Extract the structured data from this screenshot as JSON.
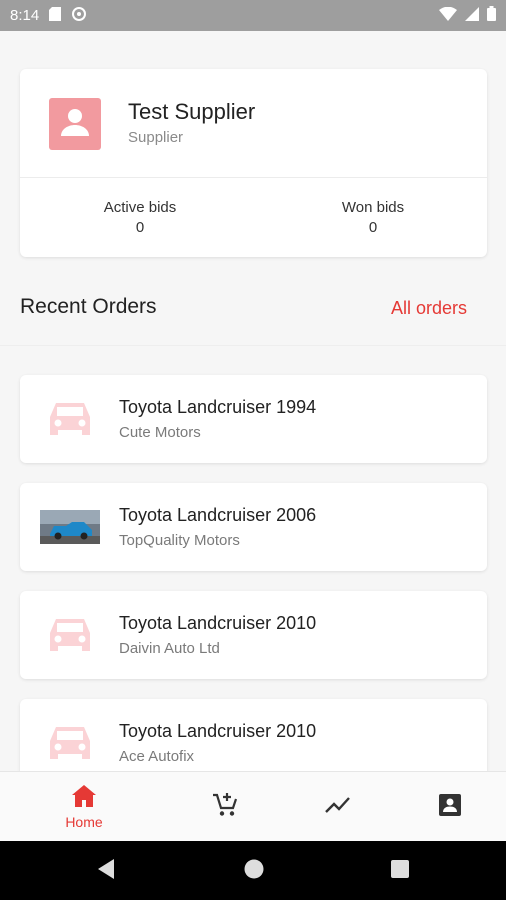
{
  "status_bar": {
    "time": "8:14"
  },
  "profile": {
    "name": "Test Supplier",
    "role": "Supplier",
    "stats": [
      {
        "label": "Active bids",
        "value": "0"
      },
      {
        "label": "Won bids",
        "value": "0"
      }
    ]
  },
  "recent_orders": {
    "title": "Recent Orders",
    "all_orders_label": "All orders",
    "items": [
      {
        "title": "Toyota Landcruiser 1994",
        "subtitle": "Cute Motors",
        "thumb": "car-placeholder-icon"
      },
      {
        "title": "Toyota Landcruiser 2006",
        "subtitle": "TopQuality Motors",
        "thumb": "car-photo"
      },
      {
        "title": "Toyota Landcruiser 2010",
        "subtitle": "Daivin Auto Ltd",
        "thumb": "car-placeholder-icon"
      },
      {
        "title": "Toyota Landcruiser 2010",
        "subtitle": "Ace Autofix",
        "thumb": "car-placeholder-icon"
      }
    ]
  },
  "bottom_nav": {
    "items": [
      {
        "label": "Home",
        "icon": "home-icon",
        "active": true
      },
      {
        "label": "",
        "icon": "add-to-cart-icon",
        "active": false
      },
      {
        "label": "",
        "icon": "trending-icon",
        "active": false
      },
      {
        "label": "",
        "icon": "account-box-icon",
        "active": false
      }
    ]
  },
  "colors": {
    "accent": "#e53935",
    "avatar_bg": "#f29a9f",
    "placeholder_car": "#fbd3d6"
  }
}
